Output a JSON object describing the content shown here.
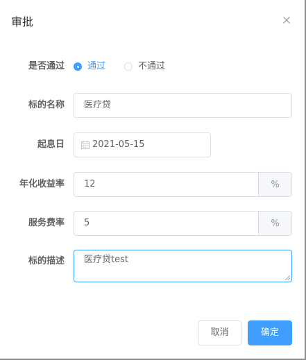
{
  "dialog": {
    "title": "审批",
    "close_icon": "close-icon"
  },
  "form": {
    "pass": {
      "label": "是否通过",
      "options": [
        {
          "label": "通过",
          "checked": true
        },
        {
          "label": "不通过",
          "checked": false
        }
      ]
    },
    "target_name": {
      "label": "标的名称",
      "value": "医疗贷"
    },
    "start_date": {
      "label": "起息日",
      "value": "2021-05-15",
      "icon": "calendar-icon"
    },
    "annual_rate": {
      "label": "年化收益率",
      "value": "12",
      "unit": "%"
    },
    "service_rate": {
      "label": "服务费率",
      "value": "5",
      "unit": "%"
    },
    "description": {
      "label": "标的描述",
      "value": "医疗贷test"
    }
  },
  "footer": {
    "cancel_label": "取消",
    "confirm_label": "确定"
  },
  "colors": {
    "primary": "#409eff",
    "border": "#dcdfe6",
    "addon_bg": "#f5f7fa"
  }
}
